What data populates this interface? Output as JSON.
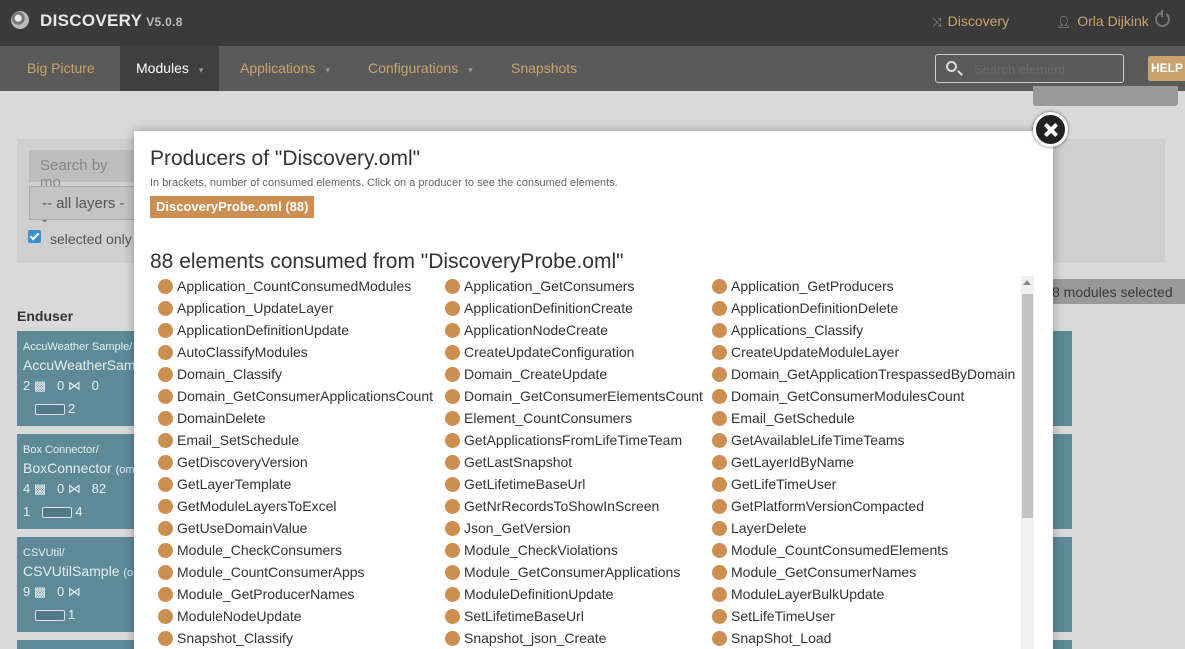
{
  "app": {
    "name": "DISCOVERY",
    "version": "V5.0.8",
    "discovery_link": "Discovery",
    "user": "Orla Dijkink"
  },
  "nav": {
    "items": [
      {
        "label": "Big Picture"
      },
      {
        "label": "Modules"
      },
      {
        "label": "Applications"
      },
      {
        "label": "Configurations"
      },
      {
        "label": "Snapshots"
      }
    ],
    "search_placeholder": "Search element",
    "help_label": "HELP"
  },
  "background": {
    "search_placeholder": "Search by mo",
    "layers_select": "-- all layers --",
    "selected_only_label": "selected only",
    "modules_selected": "8 modules selected",
    "enduser_heading": "Enduser",
    "cards": [
      {
        "crumb": "AccuWeather Sample/",
        "name": "AccuWeatherSam",
        "stat1": "2",
        "stat2": "0",
        "stat3": "0",
        "flow_in": "",
        "flow_out": "2"
      },
      {
        "crumb": "Box Connector/",
        "name": "BoxConnector",
        "suffix": "(om",
        "stat1": "4",
        "stat2": "0",
        "stat3": "82",
        "flow_in": "1",
        "flow_out": "4"
      },
      {
        "crumb": "CSVUtil/",
        "name": "CSVUtilSample",
        "suffix": "(o",
        "stat1": "9",
        "stat2": "0",
        "stat3": "",
        "flow_in": "",
        "flow_out": "1"
      }
    ]
  },
  "modal": {
    "title": "Producers of \"Discovery.oml\"",
    "hint": "In brackets, number of consumed elements. Click on a producer to see the consumed elements.",
    "producer": "DiscoveryProbe.oml (88)",
    "consumed_title": "88 elements consumed from \"DiscoveryProbe.oml\"",
    "columns": [
      [
        "Application_CountConsumedModules",
        "Application_UpdateLayer",
        "ApplicationDefinitionUpdate",
        "AutoClassifyModules",
        "Domain_Classify",
        "Domain_GetConsumerApplicationsCount",
        "DomainDelete",
        "Email_SetSchedule",
        "GetDiscoveryVersion",
        "GetLayerTemplate",
        "GetModuleLayersToExcel",
        "GetUseDomainValue",
        "Module_CheckConsumers",
        "Module_CountConsumerApps",
        "Module_GetProducerNames",
        "ModuleNodeUpdate",
        "Snapshot_Classify"
      ],
      [
        "Application_GetConsumers",
        "ApplicationDefinitionCreate",
        "ApplicationNodeCreate",
        "CreateUpdateConfiguration",
        "Domain_CreateUpdate",
        "Domain_GetConsumerElementsCount",
        "Element_CountConsumers",
        "GetApplicationsFromLifeTimeTeam",
        "GetLastSnapshot",
        "GetLifetimeBaseUrl",
        "GetNrRecordsToShowInScreen",
        "Json_GetVersion",
        "Module_CheckViolations",
        "Module_GetConsumerApplications",
        "ModuleDefinitionUpdate",
        "SetLifetimeBaseUrl",
        "Snapshot_json_Create"
      ],
      [
        "Application_GetProducers",
        "ApplicationDefinitionDelete",
        "Applications_Classify",
        "CreateUpdateModuleLayer",
        "Domain_GetApplicationTrespassedByDomain",
        "Domain_GetConsumerModulesCount",
        "Email_GetSchedule",
        "GetAvailableLifeTimeTeams",
        "GetLayerIdByName",
        "GetLifeTimeUser",
        "GetPlatformVersionCompacted",
        "LayerDelete",
        "Module_CountConsumedElements",
        "Module_GetConsumerNames",
        "ModuleLayerBulkUpdate",
        "SetLifeTimeUser",
        "SnapShot_Load"
      ]
    ]
  }
}
